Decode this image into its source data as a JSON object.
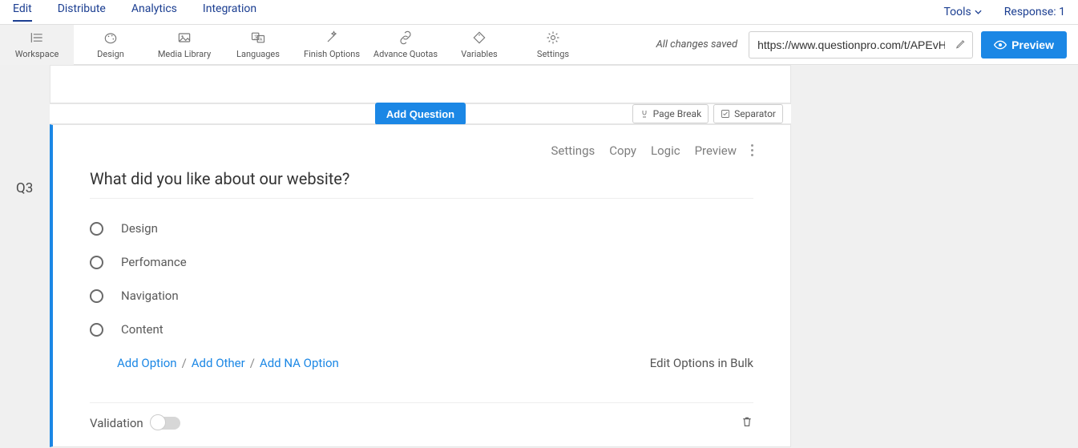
{
  "topnav": {
    "tabs": [
      "Edit",
      "Distribute",
      "Analytics",
      "Integration"
    ],
    "tools_label": "Tools",
    "response_label": "Response: 1"
  },
  "toolbar": {
    "items": [
      {
        "label": "Workspace"
      },
      {
        "label": "Design"
      },
      {
        "label": "Media Library"
      },
      {
        "label": "Languages"
      },
      {
        "label": "Finish Options"
      },
      {
        "label": "Advance Quotas"
      },
      {
        "label": "Variables"
      },
      {
        "label": "Settings"
      }
    ],
    "saved_text": "All changes saved",
    "url_value": "https://www.questionpro.com/t/APEvH",
    "preview_label": "Preview"
  },
  "insert": {
    "add_question": "Add Question",
    "page_break": "Page Break",
    "separator": "Separator"
  },
  "question": {
    "number": "Q3",
    "actions": {
      "settings": "Settings",
      "copy": "Copy",
      "logic": "Logic",
      "preview": "Preview"
    },
    "title": "What did you like about our website?",
    "options": [
      "Design",
      "Perfomance",
      "Navigation",
      "Content"
    ],
    "add_option": "Add Option",
    "add_other": "Add Other",
    "add_na": "Add NA Option",
    "bulk_edit": "Edit Options in Bulk",
    "validation_label": "Validation"
  }
}
